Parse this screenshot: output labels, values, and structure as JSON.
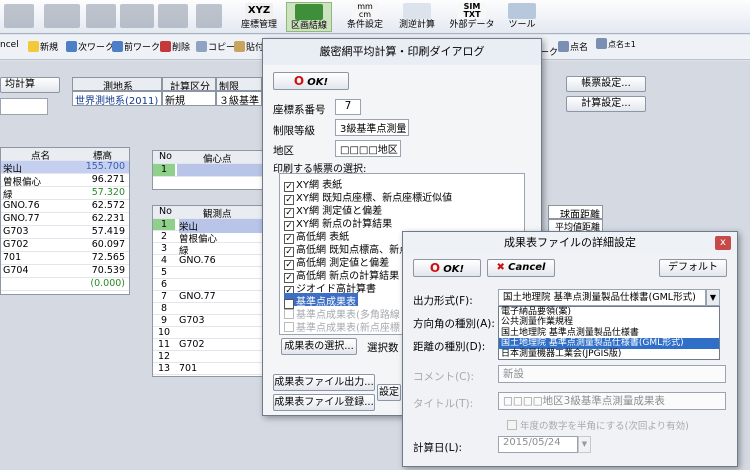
{
  "ribbon": {
    "buttons": [
      {
        "icon": "xyz-coordinate-icon",
        "label": "座標管理",
        "sub": "XYZ"
      },
      {
        "icon": "section-connect-icon",
        "label": "区画結線"
      },
      {
        "icon": "condition-setting-icon",
        "label": "条件設定",
        "sub": "mm cm"
      },
      {
        "icon": "reverse-calc-icon",
        "label": "測逆計算"
      },
      {
        "icon": "sim-txt-icon",
        "label": "外部データ",
        "sub": "SIM TXT"
      },
      {
        "icon": "tool-icon",
        "label": "ツール"
      }
    ]
  },
  "toolbar": {
    "items": [
      {
        "icon": "cancel-icon",
        "label": "ncel"
      },
      {
        "icon": "new-icon",
        "label": "新規"
      },
      {
        "icon": "next-work-icon",
        "label": "次ワーク"
      },
      {
        "icon": "prev-work-icon",
        "label": "前ワーク"
      },
      {
        "icon": "delete-icon",
        "label": "削除"
      },
      {
        "icon": "copy-icon",
        "label": "コピー"
      },
      {
        "icon": "paste-icon",
        "label": "貼付"
      }
    ],
    "right_items": [
      {
        "icon": "point-name-icon",
        "label": "点名"
      },
      {
        "icon": "point-name-plus-icon",
        "label": "点名±1"
      }
    ],
    "fragment_label": "ーク"
  },
  "main": {
    "calc_fragment": "均計算",
    "info_headers": [
      "測地系",
      "計算区分",
      "制限"
    ],
    "info_values": [
      "世界測地系(2011)",
      "新規",
      "３級基準"
    ],
    "ledger_button": "帳票設定...",
    "calc_setting_button": "計算設定...",
    "left_grid": {
      "headers": [
        "点名",
        "標高"
      ],
      "rows": [
        [
          "栄山",
          "155.700"
        ],
        [
          "曽根偏心",
          "96.271"
        ],
        [
          "緑",
          "57.320"
        ],
        [
          "GNO.76",
          "62.572"
        ],
        [
          "GNO.77",
          "62.231"
        ],
        [
          "G703",
          "57.419"
        ],
        [
          "G702",
          "60.097"
        ],
        [
          "701",
          "72.565"
        ],
        [
          "G704",
          "70.539"
        ],
        [
          "",
          "(0.000)"
        ]
      ]
    },
    "mid_grid_top": {
      "headers": [
        "No",
        "偏心点"
      ],
      "rows": [
        [
          "1",
          ""
        ]
      ]
    },
    "mid_grid": {
      "headers": [
        "No",
        "観測点"
      ],
      "rows": [
        [
          "1",
          "栄山"
        ],
        [
          "2",
          "曽根偏心"
        ],
        [
          "3",
          "緑"
        ],
        [
          "4",
          "GNO.76"
        ],
        [
          "5",
          ""
        ],
        [
          "6",
          ""
        ],
        [
          "7",
          "GNO.77"
        ],
        [
          "8",
          ""
        ],
        [
          "9",
          "G703"
        ],
        [
          "10",
          ""
        ],
        [
          "11",
          "G702"
        ],
        [
          "12",
          ""
        ],
        [
          "13",
          "701"
        ]
      ]
    },
    "right_labels": [
      "球面距離",
      "平均値距離"
    ]
  },
  "print_dialog": {
    "title": "厳密網平均計算・印刷ダイアログ",
    "ok_label": "OK!",
    "coord_label": "座標系番号",
    "coord_value": "7",
    "grade_label": "制限等級",
    "grade_value": "3級基準点測量",
    "area_label": "地区",
    "area_value": "□□□□地区",
    "select_label": "印刷する帳票の選択:",
    "checklist": [
      {
        "label": "XY網 表紙",
        "checked": true,
        "enabled": true
      },
      {
        "label": "XY網 既知点座標、新点座標近似値",
        "checked": true,
        "enabled": true
      },
      {
        "label": "XY網 測定値と偏差",
        "checked": true,
        "enabled": true
      },
      {
        "label": "XY網 新点の計算結果",
        "checked": true,
        "enabled": true
      },
      {
        "label": "高低網 表紙",
        "checked": true,
        "enabled": true
      },
      {
        "label": "高低網 既知点標高、新点",
        "checked": true,
        "enabled": true
      },
      {
        "label": "高低網 測定値と偏差",
        "checked": true,
        "enabled": true
      },
      {
        "label": "高低網 新点の計算結果",
        "checked": true,
        "enabled": true
      },
      {
        "label": "ジオイド高計算書",
        "checked": true,
        "enabled": true
      },
      {
        "label": "基準点成果表",
        "checked": true,
        "enabled": true
      },
      {
        "label": "基準点成果表(多角路線",
        "checked": false,
        "enabled": false
      },
      {
        "label": "基準点成果表(新点座標",
        "checked": false,
        "enabled": false
      }
    ],
    "results_button": "成果表の選択...",
    "count_label": "選択数",
    "output_button": "成果表ファイル出力...",
    "register_button": "成果表ファイル登録...",
    "setting_button": "設定"
  },
  "detail_dialog": {
    "title": "成果表ファイルの詳細設定",
    "close_label": "x",
    "ok_label": "OK!",
    "cancel_label": "Cancel",
    "default_label": "デフォルト",
    "format_label": "出力形式(F):",
    "format_selected": "国土地理院 基準点測量製品仕様書(GML形式)",
    "format_options": [
      "電子納品要領(案)",
      "公共測量作業規程",
      "国土地理院 基準点測量製品仕様書",
      "国土地理院 基準点測量製品仕様書(GML形式)",
      "日本測量機器工業会(JPGIS版)"
    ],
    "format_highlighted_index": 3,
    "direction_label": "方向角の種別(A):",
    "distance_label": "距離の種別(D):",
    "comment_label": "コメント(C):",
    "comment_value": "新設",
    "title_label": "タイトル(T):",
    "title_value": "□□□□地区3級基準点測量成果表",
    "halfwidth_label": "年度の数字を半角にする(次回より有効)",
    "date_label": "計算日(L):",
    "date_value": "2015/05/24",
    "accent": "#2f6fc8"
  }
}
